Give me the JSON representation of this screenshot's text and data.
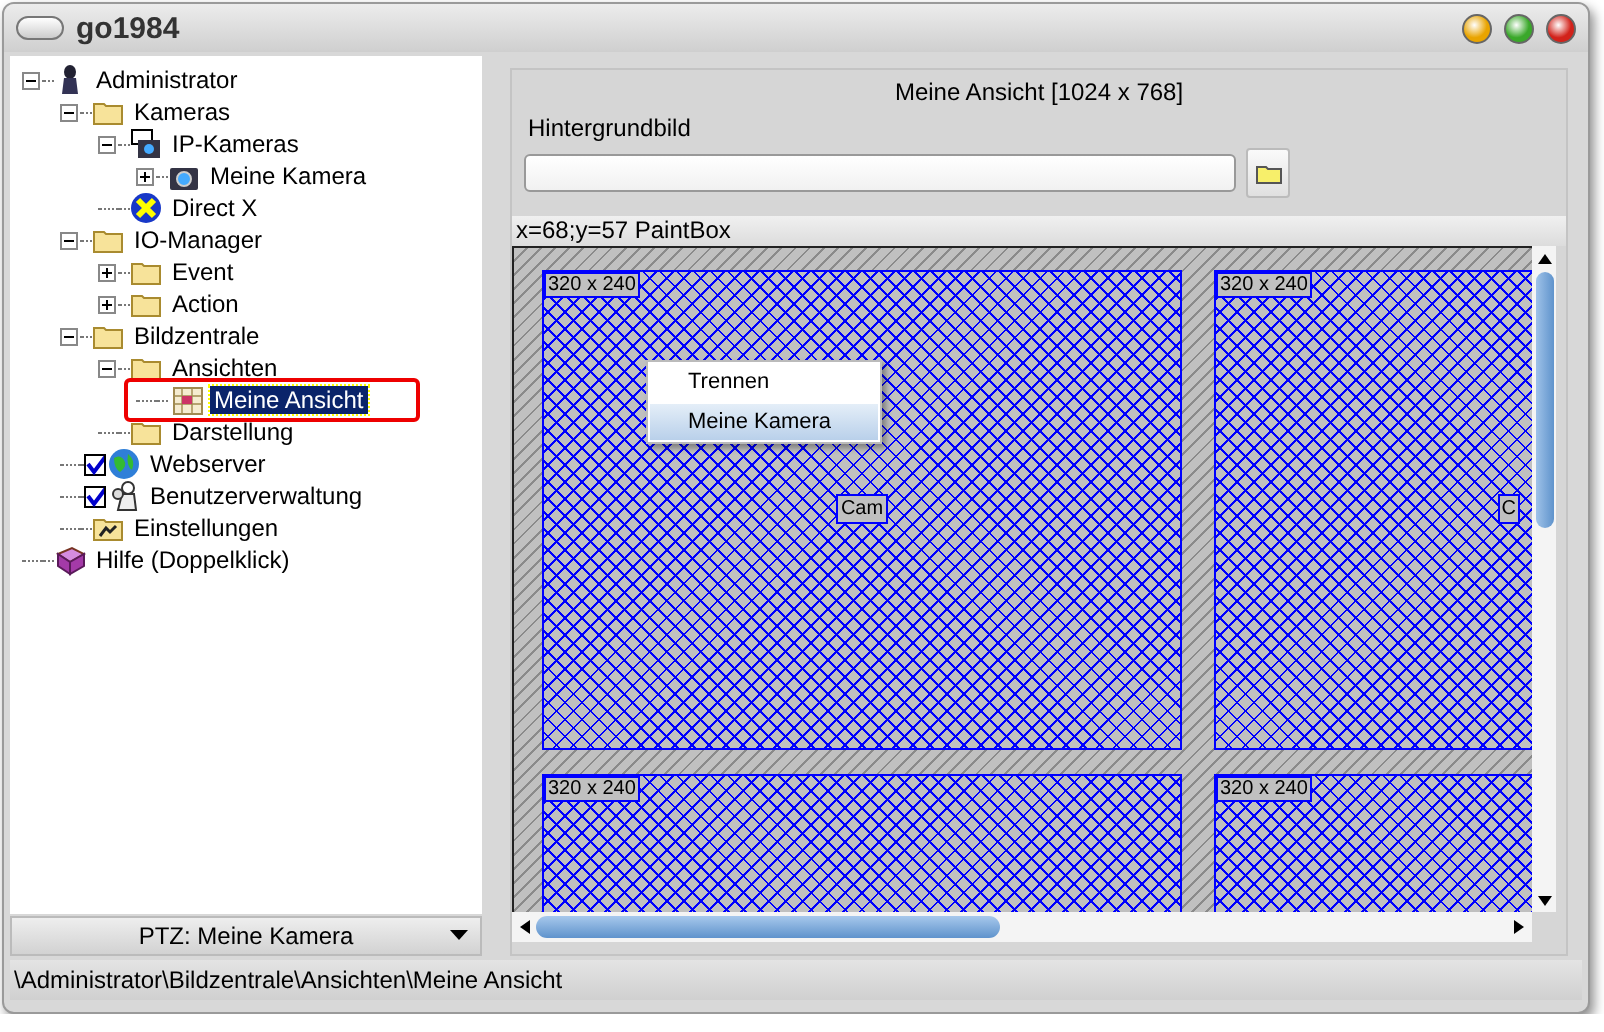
{
  "window": {
    "title": "go1984"
  },
  "tree": [
    {
      "label": "Administrator",
      "kind": "admin",
      "expanded": true,
      "selected": false,
      "children": [
        {
          "label": "Kameras",
          "kind": "folder",
          "expanded": true,
          "selected": false,
          "children": [
            {
              "label": "IP-Kameras",
              "kind": "ipcam",
              "expanded": true,
              "selected": false,
              "children": [
                {
                  "label": "Meine Kamera",
                  "kind": "camera",
                  "expanded": false,
                  "selected": false
                }
              ]
            },
            {
              "label": "Direct X",
              "kind": "directx",
              "selected": false
            }
          ]
        },
        {
          "label": "IO-Manager",
          "kind": "folder",
          "expanded": true,
          "selected": false,
          "children": [
            {
              "label": "Event",
              "kind": "folder",
              "expanded": false,
              "selected": false
            },
            {
              "label": "Action",
              "kind": "folder",
              "expanded": false,
              "selected": false
            }
          ]
        },
        {
          "label": "Bildzentrale",
          "kind": "folder",
          "expanded": true,
          "selected": false,
          "children": [
            {
              "label": "Ansichten",
              "kind": "folder",
              "expanded": true,
              "selected": false,
              "children": [
                {
                  "label": "Meine Ansicht",
                  "kind": "grid",
                  "selected": true
                }
              ]
            },
            {
              "label": "Darstellung",
              "kind": "folder",
              "selected": false
            }
          ]
        },
        {
          "label": "Webserver",
          "kind": "globe",
          "checked": true,
          "selected": false
        },
        {
          "label": "Benutzerverwaltung",
          "kind": "users",
          "checked": true,
          "selected": false
        },
        {
          "label": "Einstellungen",
          "kind": "settings",
          "selected": false
        }
      ]
    },
    {
      "label": "Hilfe (Doppelklick)",
      "kind": "book",
      "selected": false
    }
  ],
  "ptz_selector": {
    "value": "PTZ: Meine Kamera"
  },
  "view_editor": {
    "title": "Meine Ansicht [1024 x 768]",
    "background_label": "Hintergrundbild",
    "canvas_status": "x=68;y=57 PaintBox",
    "panes": [
      {
        "size": "320 x 240",
        "cam_label": "Cam"
      },
      {
        "size": "320 x 240",
        "cam_label": "C"
      },
      {
        "size": "320 x 240"
      },
      {
        "size": "320 x 240"
      }
    ],
    "context_menu": [
      {
        "label": "Trennen",
        "selected": false
      },
      {
        "label": "Meine Kamera",
        "selected": true
      }
    ]
  },
  "status_bar": "\\Administrator\\Bildzentrale\\Ansichten\\Meine Ansicht"
}
